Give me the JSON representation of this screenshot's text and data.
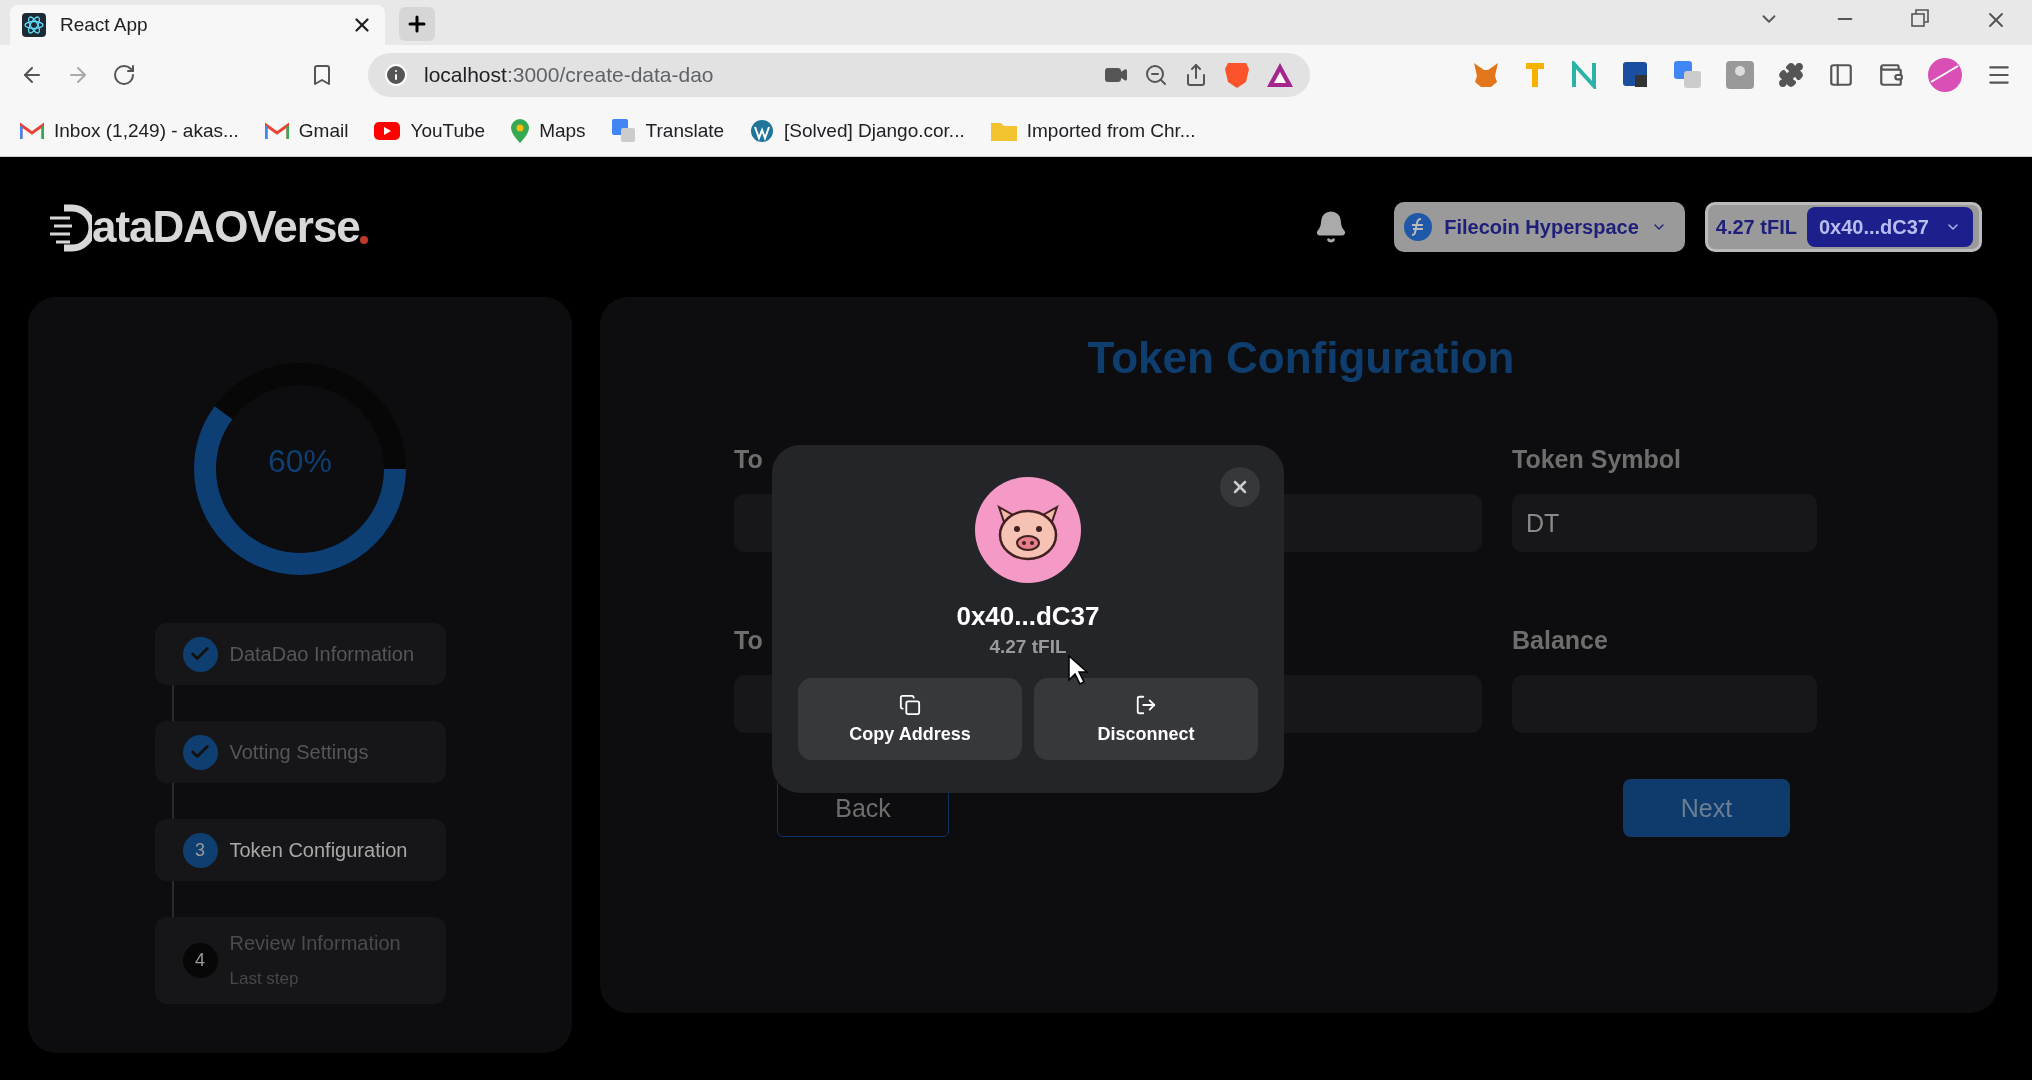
{
  "browser": {
    "tab": {
      "title": "React App"
    },
    "address": {
      "host": "localhost",
      "path": ":3000/create-data-dao"
    },
    "bookmarks": [
      {
        "label": "Inbox (1,249) - akas..."
      },
      {
        "label": "Gmail"
      },
      {
        "label": "YouTube"
      },
      {
        "label": "Maps"
      },
      {
        "label": "Translate"
      },
      {
        "label": "[Solved] Django.cor..."
      },
      {
        "label": "Imported from Chr..."
      }
    ]
  },
  "header": {
    "logo_text": "ataDAOVerse",
    "network": "Filecoin Hyperspace",
    "balance": "4.27 tFIL",
    "account": "0x40...dC37"
  },
  "sidebar": {
    "progress": {
      "level": 0.6,
      "label": "60%"
    },
    "steps": [
      {
        "label": "DataDao Information",
        "kind": "done"
      },
      {
        "label": "Votting Settings",
        "kind": "done"
      },
      {
        "label": "Token Configuration",
        "kind": "current",
        "number": "3"
      },
      {
        "label": "Review Information",
        "kind": "upcoming",
        "number": "4",
        "sublabel": "Last step"
      }
    ]
  },
  "main": {
    "title": "Token Configuration",
    "rows": [
      [
        {
          "label": "To"
        },
        {},
        {
          "label": "Token Symbol",
          "value": "DT"
        }
      ],
      [
        {
          "label": "To"
        },
        {},
        {
          "label": "Balance"
        }
      ]
    ],
    "back": "Back",
    "next": "Next"
  },
  "modal": {
    "address": "0x40...dC37",
    "balance": "4.27 tFIL",
    "actions": [
      {
        "label": "Copy Address",
        "kind": "copy"
      },
      {
        "label": "Disconnect",
        "kind": "disconnect"
      }
    ]
  }
}
